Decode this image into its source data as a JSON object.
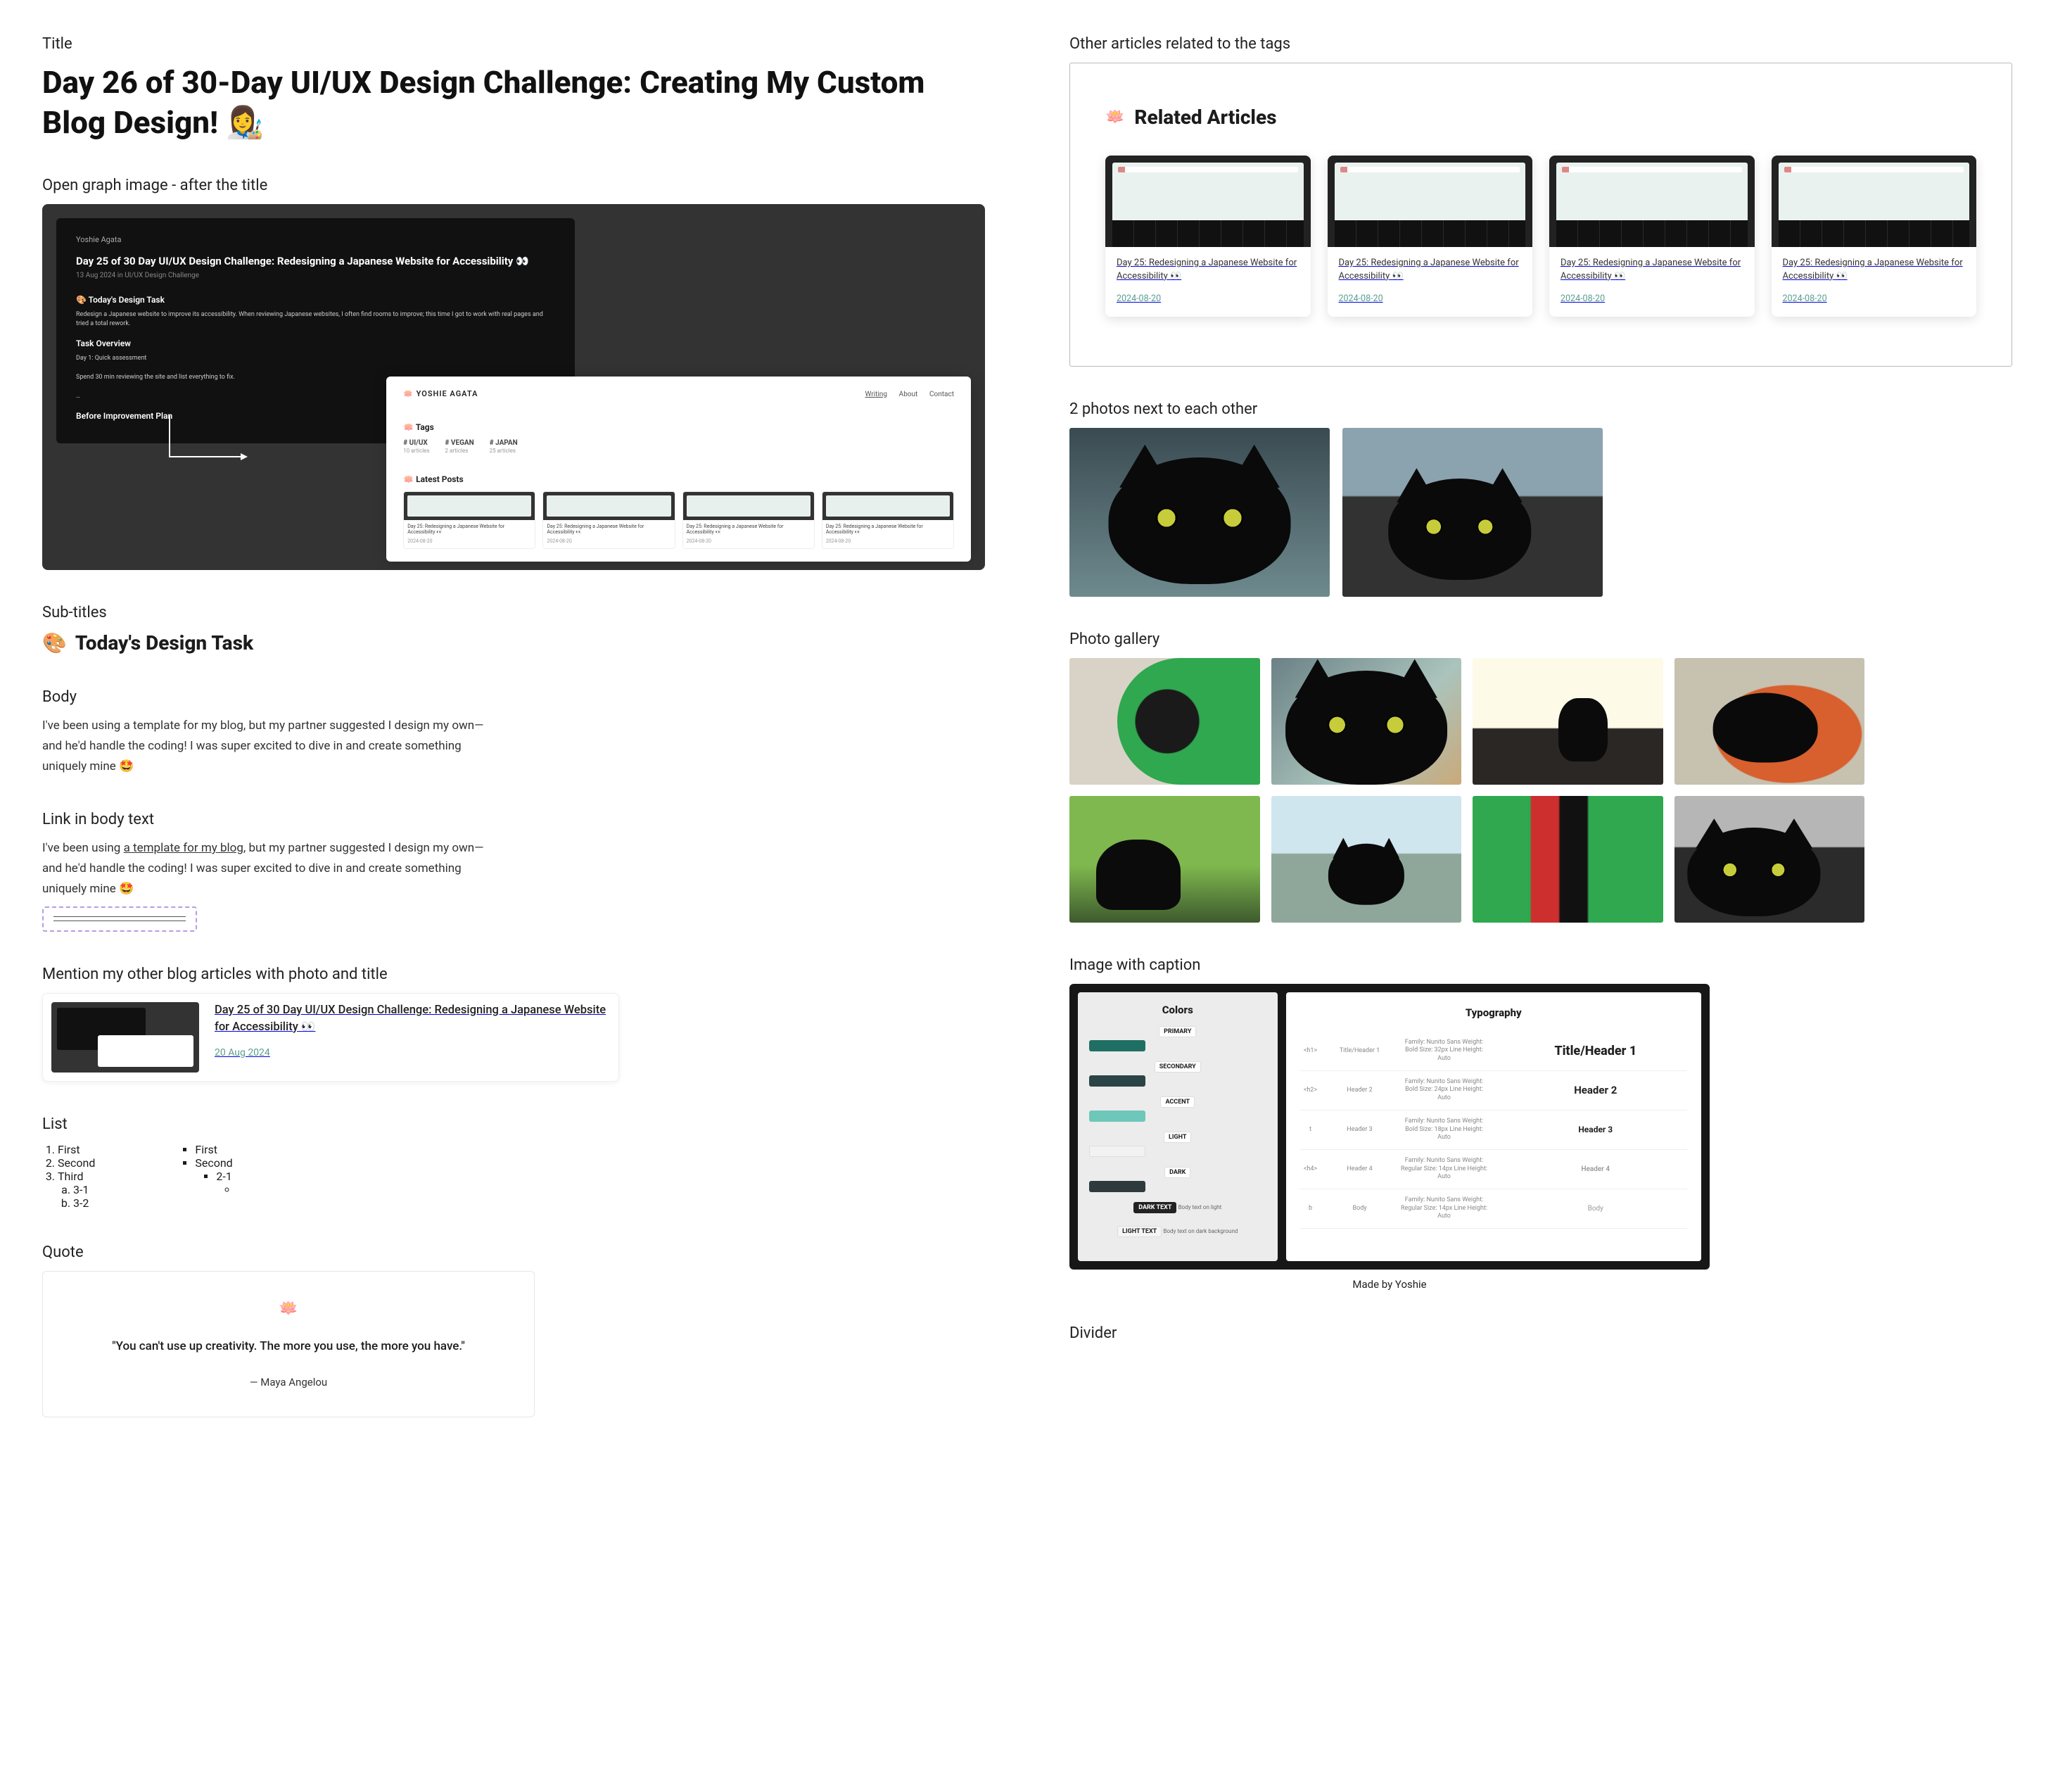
{
  "labels": {
    "title": "Title",
    "og": "Open  graph image - after the title",
    "subtitles": "Sub-titles",
    "body": "Body",
    "link": "Link in body text",
    "ref": "Mention my other blog articles with photo and title",
    "list": "List",
    "quote": "Quote",
    "related": "Other articles related to the tags",
    "two_photos": "2 photos next to each other",
    "gallery": "Photo gallery",
    "caption": "Image with caption",
    "divider": "Divider"
  },
  "title": "Day 26 of 30-Day UI/UX Design Challenge: Creating My Custom Blog Design! 👩‍🎨",
  "og": {
    "author": "Yoshie Agata",
    "article_title": "Day 25 of 30 Day UI/UX Design Challenge: Redesigning a Japanese Website for Accessibility 👀",
    "meta": "13 Aug 2024 in UI/UX Design Challenge",
    "task_heading": "🎨 Today's Design Task",
    "para1": "Redesign a Japanese website to improve its accessibility. When reviewing Japanese websites, I often find rooms to improve; this time I got to work with real pages and tried a total rework.",
    "overview": "Task Overview",
    "plan1": "Day 1: Quick assessment",
    "plan1b": "Spend 30 min reviewing the site and list everything to fix.",
    "plan2": "Before Improvement Plan",
    "white": {
      "logo": "YOSHIE AGATA",
      "nav": [
        "Writing",
        "About",
        "Contact"
      ],
      "tags_label": "Tags",
      "tags": [
        {
          "name": "# UI/UX",
          "count": "10 articles"
        },
        {
          "name": "# VEGAN",
          "count": "2 articles"
        },
        {
          "name": "# JAPAN",
          "count": "25 articles"
        }
      ],
      "latest_label": "Latest Posts",
      "mini_title": "Day 25: Redesigning a Japanese Website for Accessibility 👀",
      "mini_date": "2024-08-20"
    }
  },
  "subtitle": {
    "emoji": "🎨",
    "text": "Today's Design Task"
  },
  "body_text": "I've been using a template for my blog, but my partner suggested I design my own—and he'd handle the coding! I was super excited to dive in and create something uniquely mine 🤩",
  "link_text_before": "I've been using ",
  "link_text_link": "a template for my blog",
  "link_text_after": ", but my partner suggested I design my own—and he'd handle the coding! I was super excited to dive in and create something uniquely mine 🤩",
  "ref": {
    "title": "Day 25 of 30 Day UI/UX Design Challenge: Redesigning a Japanese Website for Accessibility 👀",
    "date": "20 Aug 2024"
  },
  "list": {
    "ordered": [
      "First",
      "Second",
      "Third"
    ],
    "ordered_sub": [
      "3-1",
      "3-2"
    ],
    "unordered": [
      "First",
      "Second"
    ],
    "unordered_sub": "2-1"
  },
  "quote": {
    "text": "\"You can't use up creativity. The more you use, the more you have.\"",
    "author": "— Maya Angelou"
  },
  "related": {
    "heading": "Related Articles",
    "card_title": "Day 25: Redesigning a Japanese Website for Accessibility 👀",
    "card_date": "2024-08-20"
  },
  "figure": {
    "left_title": "Colors",
    "swatches": [
      "PRIMARY",
      "SECONDARY",
      "ACCENT",
      "LIGHT",
      "DARK",
      "DARK TEXT",
      "LIGHT TEXT"
    ],
    "dt_note": "Body text on light",
    "lt_note": "Body text on dark background",
    "right_title": "Typography",
    "rows": [
      {
        "tag": "<h1>",
        "name": "Title/Header 1",
        "spec": "Family: Nunito Sans\nWeight: Bold\nSize: 32px\nLine Height: Auto",
        "sample": "Title/Header 1"
      },
      {
        "tag": "<h2>",
        "name": "Header 2",
        "spec": "Family: Nunito Sans\nWeight: Bold\nSize: 24px\nLine Height: Auto",
        "sample": "Header 2"
      },
      {
        "tag": "t",
        "name": "Header 3",
        "spec": "Family: Nunito Sans\nWeight: Bold\nSize: 18px\nLine Height: Auto",
        "sample": "Header 3"
      },
      {
        "tag": "<h4>",
        "name": "Header 4",
        "spec": "Family: Nunito Sans\nWeight: Regular\nSize: 14px\nLine Height: Auto",
        "sample": "Header 4"
      },
      {
        "tag": "b",
        "name": "Body",
        "spec": "Family: Nunito Sans\nWeight: Regular\nSize: 14px\nLine Height: Auto",
        "sample": "Body"
      }
    ],
    "caption": "Made by Yoshie"
  }
}
